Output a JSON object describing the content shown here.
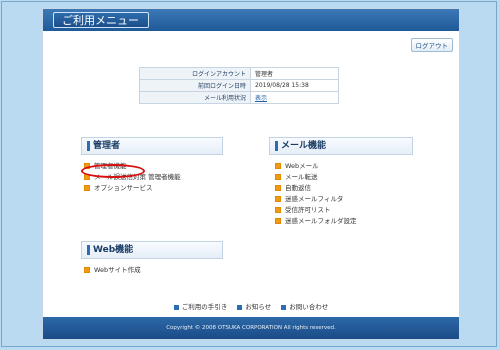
{
  "header": {
    "title": "ご利用メニュー"
  },
  "logout_label": "ログアウト",
  "info": [
    {
      "key": "ログインアカウント",
      "value": "管理者"
    },
    {
      "key": "前回ログイン日時",
      "value": "2019/08/28 15:38"
    },
    {
      "key": "メール利用状況",
      "value": "表示"
    }
  ],
  "admin": {
    "title": "管理者",
    "items": [
      "管理者機能",
      "メール誤送信対策 管理者機能",
      "オプションサービス"
    ]
  },
  "web": {
    "title": "Web機能",
    "items": [
      "Webサイト作成"
    ]
  },
  "mail": {
    "title": "メール機能",
    "items": [
      "Webメール",
      "メール転送",
      "自動返信",
      "迷惑メールフィルタ",
      "受信許可リスト",
      "迷惑メールフォルダ設定"
    ]
  },
  "footer_links": [
    "ご利用の手引き",
    "お知らせ",
    "お問い合わせ"
  ],
  "copyright": "Copyright © 2008 OTSUKA CORPORATION All rights reserved.",
  "colors": {
    "header": "#1e5a98",
    "bullet": "#f29a13",
    "highlight": "#d80f0f",
    "background": "#b9daf0"
  }
}
